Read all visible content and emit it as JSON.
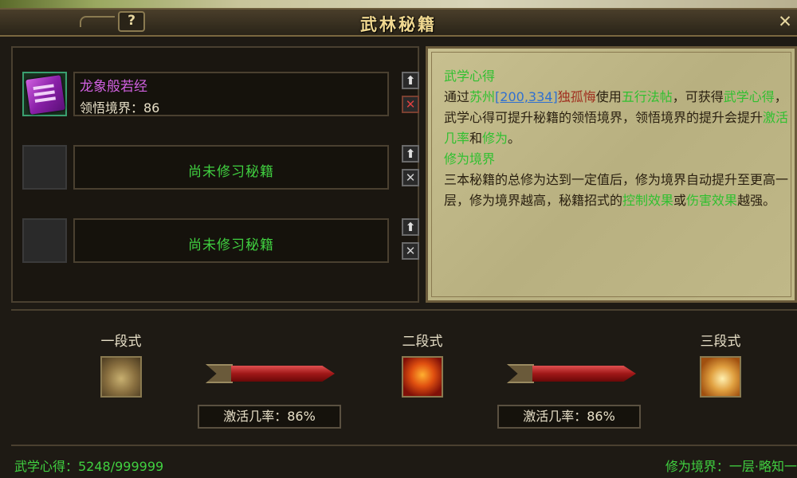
{
  "window": {
    "title": "武林秘籍",
    "help_label": "?",
    "close_label": "✕"
  },
  "slots": [
    {
      "name": "龙象般若经",
      "level_text": "领悟境界：86",
      "up_icon": "⬆",
      "remove_icon": "✕",
      "icon": "book-icon",
      "name_color": "#d060e0"
    },
    {
      "empty_text": "尚未修习秘籍",
      "up_icon": "⬆",
      "remove_icon": "✕"
    },
    {
      "empty_text": "尚未修习秘籍",
      "up_icon": "⬆",
      "remove_icon": "✕"
    }
  ],
  "info": {
    "section1_title": "武学心得",
    "s1_a": "通过",
    "s1_city": "苏州",
    "s1_coord": "[200,334]",
    "s1_npc": "独孤悔",
    "s1_b": "使用",
    "s1_item": "五行法帖",
    "s1_c": "，可获得",
    "s1_d": "武学心得",
    "s1_e": "，武学心得可提升秘籍的领悟境界，领悟境界的提升会提升",
    "s1_f": "激活几率",
    "s1_g": "和",
    "s1_h": "修为",
    "s1_i": "。",
    "section2_title": "修为境界",
    "s2_a": "三本秘籍的总修为达到一定值后，修为境界自动提升至更高一层，修为境界越高，秘籍招式的",
    "s2_b": "控制效果",
    "s2_c": "或",
    "s2_d": "伤害效果",
    "s2_e": "越强。"
  },
  "stages": [
    {
      "label": "一段式",
      "icon": "elephant-icon"
    },
    {
      "label": "二段式",
      "icon": "dragon-icon"
    },
    {
      "label": "三段式",
      "icon": "tiger-icon"
    }
  ],
  "rates": [
    {
      "text": "激活几率：86%",
      "value": 0.86
    },
    {
      "text": "激活几率：86%",
      "value": 0.86
    }
  ],
  "footer": {
    "left": "武学心得：5248/999999",
    "right": "修为境界：一层·略知一"
  },
  "colors": {
    "accent_green": "#30c030",
    "link_blue": "#3070d0",
    "npc_red": "#a03020",
    "book_purple": "#d060e0"
  }
}
